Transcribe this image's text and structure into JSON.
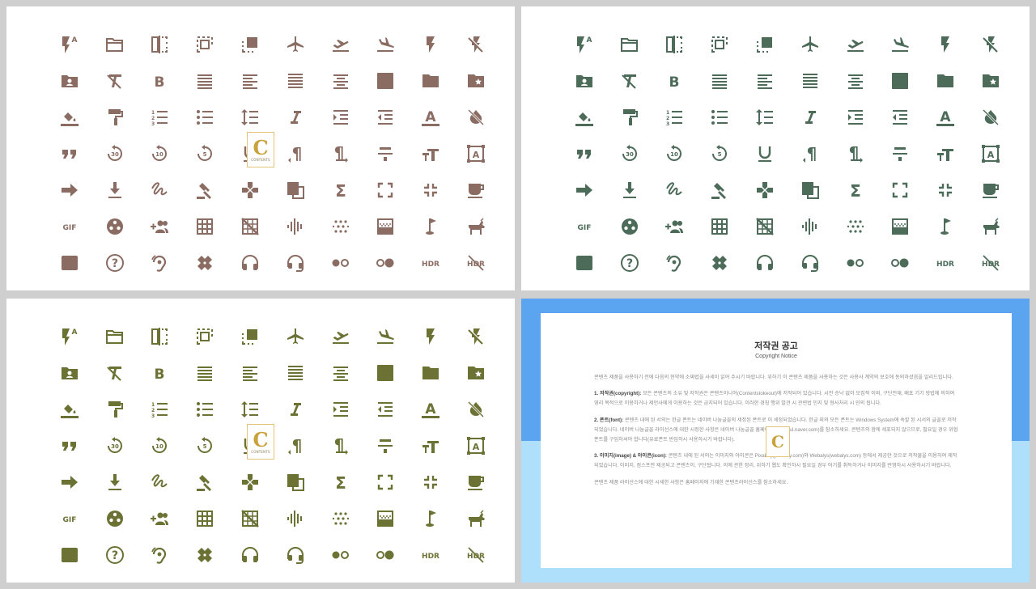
{
  "panels": [
    {
      "id": "p1",
      "color": "#8a6c62"
    },
    {
      "id": "p2",
      "color": "#4c6b59"
    },
    {
      "id": "p3",
      "color": "#6c7134"
    }
  ],
  "icons": [
    [
      "flash-auto-icon",
      "folder-open-icon",
      "flip-icon",
      "select-all-icon",
      "dashed-square-icon",
      "airplane-icon",
      "flight-takeoff-icon",
      "flight-land-icon",
      "flash-on-icon",
      "flash-off-icon"
    ],
    [
      "contact-folder-icon",
      "clear-format-icon",
      "bold-icon",
      "align-right-icon",
      "align-left-icon",
      "justify-icon",
      "align-center-icon",
      "text-box-icon",
      "folder-icon",
      "folder-special-icon"
    ],
    [
      "fill-color-icon",
      "paint-roller-icon",
      "numbered-list-icon",
      "bulleted-list-icon",
      "line-spacing-icon",
      "italic-icon",
      "indent-increase-icon",
      "indent-decrease-icon",
      "text-color-icon",
      "invert-colors-off-icon"
    ],
    [
      "quote-icon",
      "replay-30-icon",
      "replay-10-icon",
      "replay-5-icon",
      "underline-icon",
      "pilcrow-rtl-icon",
      "pilcrow-ltr-icon",
      "strikethrough-icon",
      "text-fields-icon",
      "text-select-icon"
    ],
    [
      "arrow-forward-icon",
      "download-icon",
      "gesture-icon",
      "gavel-icon",
      "gamepad-icon",
      "translate-icon",
      "sigma-icon",
      "fullscreen-icon",
      "fullscreen-exit-icon",
      "coffee-cup-icon"
    ],
    [
      "gif-icon",
      "film-reel-icon",
      "group-add-icon",
      "grid-on-icon",
      "grid-off-icon",
      "graphic-eq-icon",
      "dots-grid-icon",
      "gradient-icon",
      "golf-icon",
      "goat-icon"
    ],
    [
      "hd-icon",
      "help-icon",
      "hearing-icon",
      "healing-icon",
      "headphones-icon",
      "headset-mic-icon",
      "toggle-dots-icon",
      "toggle-dots-right-icon",
      "hdr-icon",
      "hdr-off-icon"
    ]
  ],
  "labels": {
    "a_super": "A",
    "bold": "B",
    "textbox": "A",
    "textcolor": "A",
    "italic": "I",
    "r30": "30",
    "r10": "10",
    "r5": "5",
    "gif": "GIF",
    "hd": "HD",
    "help": "?",
    "hdr": "HDR",
    "sigma": "Σ",
    "quote": "❞",
    "tt": "TT",
    "translate_g": "G",
    "u": "U",
    "pil": "¶"
  },
  "watermark": {
    "letter": "C",
    "caption": "CONTENTS"
  },
  "notice": {
    "title": "저작권 공고",
    "subtitle": "Copyright Notice",
    "intro": "콘텐츠 제품을 사용하기 전에 다음의 현약에 소짜법을 사세이 읽어 주시기 바랍니다. 위하기 이 콘텐츠 제품을 사용하는 것은 사용사 계약의 보호에 동의하셨음을 알리드립니다.",
    "s1_head": "1. 저작권(copyright):",
    "s1_text": "모든 콘텐츠의 소유 및 저작권은 콘텐츠이니어(Contentstokeout)에 저작되어 있습니다. 시전 승낙 없이 모집적 이외, 구단전재, 배포 기기 방법에 의하여 영리 목적으로 이용하거나 제언사에게 이용하는 것은 금지되어 있습니다. 이러한 경칭 행위 발견 시 관련법 인지 및 형사처리 시 민의 됩니다.",
    "s2_head": "2. 폰트(font):",
    "s2_text": "콘텐츠 내에 된 서의는 한글 폰트는 네이버 나눔글꼴의 세정된 폰트로 이 세정되었습니다. 한글 외의 모든 폰트는 Windows System에 속할 된 시서의 글꼴로 저작되었습니다. 네이버 나눔글꼴 라이선스에 대한 시정한 사항은 네이버 나눔글꼴 홈페이지(hangeul.naver.com)를 참소하세요. 콘텐츠의 함에 세포되지 않으므로, 필요일 경우 위험 폰트를 구입하셔야 합니다(유료폰트 반입하시 사용하시기 바랍니다).",
    "s3_head": "3. 이미지(image) & 아이콘(icon):",
    "s3_text": "콘텐츠 내에 된 서의는 이미지와 아이콘은 Pixabay(pixabay.com)와 Webalys(webalys.com) 등에서 제공한 것으로 저작물을 이용하여 제작되었습니다. 이미지, 점스프만 제공되고 콘텐츠이, 구단됩니다. 이에 관한 정리, 위하기 웹도 확인하시 필요일 경우 어기를 취득하거나 이미지를 반영하시 사용하시기 바랍니다.",
    "outro": "콘텐츠 제품 라이선스에 대한 시세한 사항은 홈페이지에 기재한 콘텐츠라이선스를 참소하세요."
  }
}
